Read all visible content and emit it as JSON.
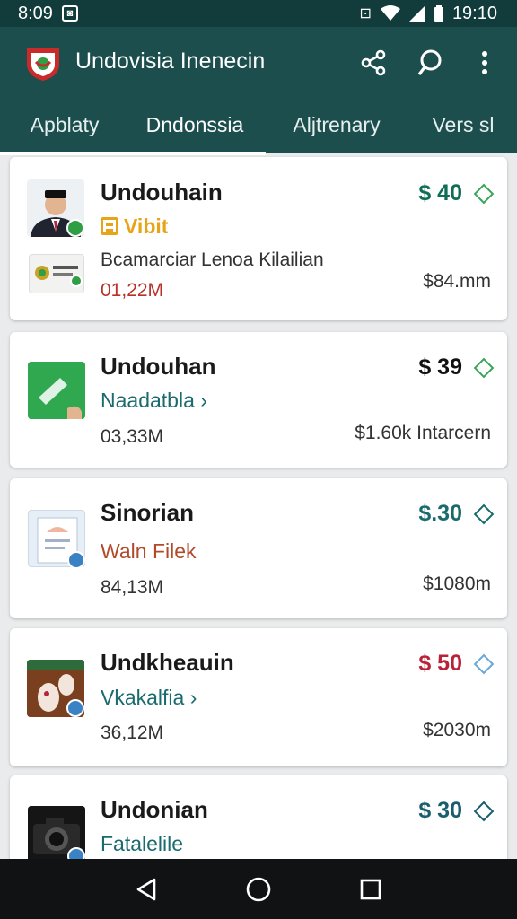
{
  "status": {
    "time": "8:09",
    "clock_right": "19:10"
  },
  "app": {
    "title": "Undovisia Inenecin"
  },
  "actions": {
    "share_icon": "share-icon",
    "search_icon": "search-icon",
    "more_icon": "more-vert-icon"
  },
  "tabs": [
    {
      "label": "Apblaty"
    },
    {
      "label": "Dndonssia"
    },
    {
      "label": "Aljtrenary"
    },
    {
      "label": "Vers sl"
    }
  ],
  "cards": [
    {
      "title": "Undouhain",
      "price": "$ 40",
      "sub": "Vibit",
      "desc": "Bcamarciar Lenoa Kilailian",
      "meta": "01,22M",
      "right": "$84.mm",
      "colors": {
        "price": "#0f6e55",
        "sub": "#e8a316",
        "meta": "#b8322a"
      }
    },
    {
      "title": "Undouhan",
      "price": "$ 39",
      "sub": "Naadatbla",
      "meta": "03,33M",
      "right": "$1.60k Intarcern",
      "colors": {
        "price": "#111111",
        "sub": "#1a6b6e"
      }
    },
    {
      "title": "Sinorian",
      "price": "$.30",
      "sub": "Waln Filek",
      "meta": "84,13M",
      "right": "$1080m",
      "colors": {
        "price": "#1a6b6e",
        "sub": "#b04a2a"
      }
    },
    {
      "title": "Undkheauin",
      "price": "$ 50",
      "sub": "Vkakalfia",
      "meta": "36,12M",
      "right": "$2030m",
      "colors": {
        "price": "#b8233a",
        "sub": "#1a6b6e"
      }
    },
    {
      "title": "Undonian",
      "price": "$ 30",
      "sub": "Fatalelile",
      "colors": {
        "price": "#1a5e6e",
        "sub": "#1a6b6e"
      }
    }
  ]
}
